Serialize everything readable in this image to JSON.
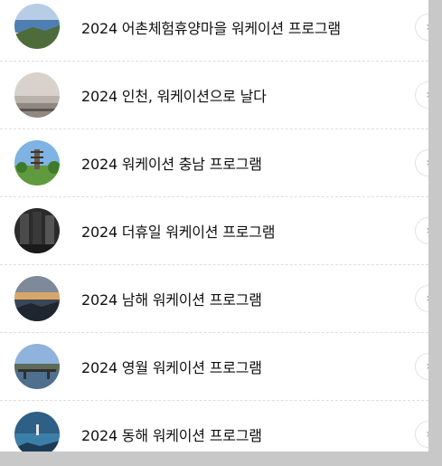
{
  "list": {
    "items": [
      {
        "title": "2024 어촌체험휴양마을 워케이션 프로그램",
        "thumb": "coast-landscape-thumbnail"
      },
      {
        "title": "2024 인천, 워케이션으로 날다",
        "thumb": "misty-beach-thumbnail"
      },
      {
        "title": "2024 워케이션 충남 프로그램",
        "thumb": "pagoda-garden-thumbnail"
      },
      {
        "title": "2024 더휴일 워케이션 프로그램",
        "thumb": "dark-interior-thumbnail"
      },
      {
        "title": "2024 남해 워케이션 프로그램",
        "thumb": "sunset-sea-thumbnail"
      },
      {
        "title": "2024 영월 워케이션 프로그램",
        "thumb": "river-bridge-thumbnail"
      },
      {
        "title": "2024 동해 워케이션 프로그램",
        "thumb": "blue-coast-thumbnail"
      }
    ],
    "chevron_icon": "chevron-right-icon",
    "chevron_glyph": "›"
  }
}
